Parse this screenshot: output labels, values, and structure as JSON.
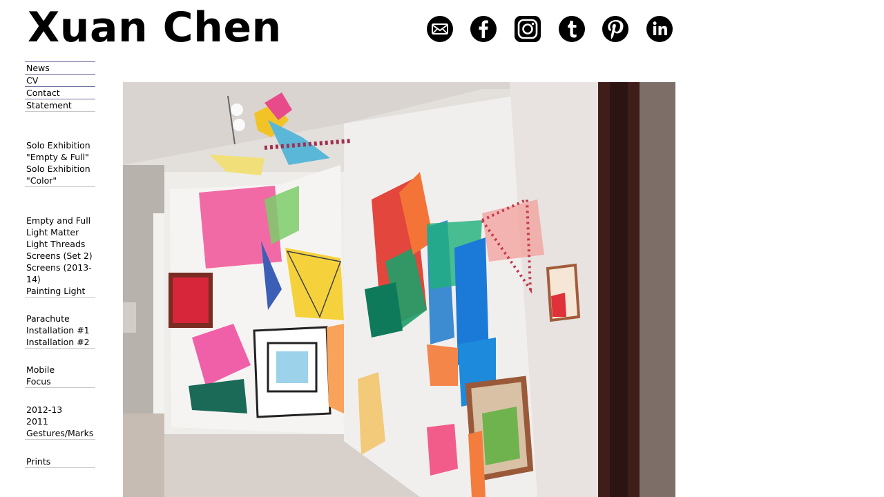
{
  "site": {
    "title": "Xuan Chen"
  },
  "social": [
    {
      "name": "email-icon",
      "label": "Email"
    },
    {
      "name": "facebook-icon",
      "label": "Facebook"
    },
    {
      "name": "instagram-icon",
      "label": "Instagram"
    },
    {
      "name": "tumblr-icon",
      "label": "Tumblr"
    },
    {
      "name": "pinterest-icon",
      "label": "Pinterest"
    },
    {
      "name": "linkedin-icon",
      "label": "LinkedIn"
    }
  ],
  "nav": {
    "main": [
      "News",
      "CV",
      "Contact",
      "Statement"
    ],
    "exhibitions": [
      "Solo Exhibition",
      "\"Empty & Full\"",
      "Solo Exhibition",
      "\"Color\""
    ],
    "works": [
      "Empty and Full",
      "Light Matter",
      "Light Threads",
      "Screens (Set 2)",
      "Screens (2013-14)",
      "Painting Light"
    ],
    "installations": [
      "Parachute",
      "Installation #1",
      "Installation #2"
    ],
    "mobile": [
      "Mobile",
      "Focus"
    ],
    "years": [
      "2012-13",
      "2011",
      "Gestures/Marks"
    ],
    "prints": [
      "Prints"
    ]
  },
  "hero": {
    "description": "Gallery installation with colorful translucent fabric panels and framed light boxes"
  },
  "colors": {
    "text": "#000000",
    "rule": "#c8c8c8",
    "background": "#ffffff"
  }
}
